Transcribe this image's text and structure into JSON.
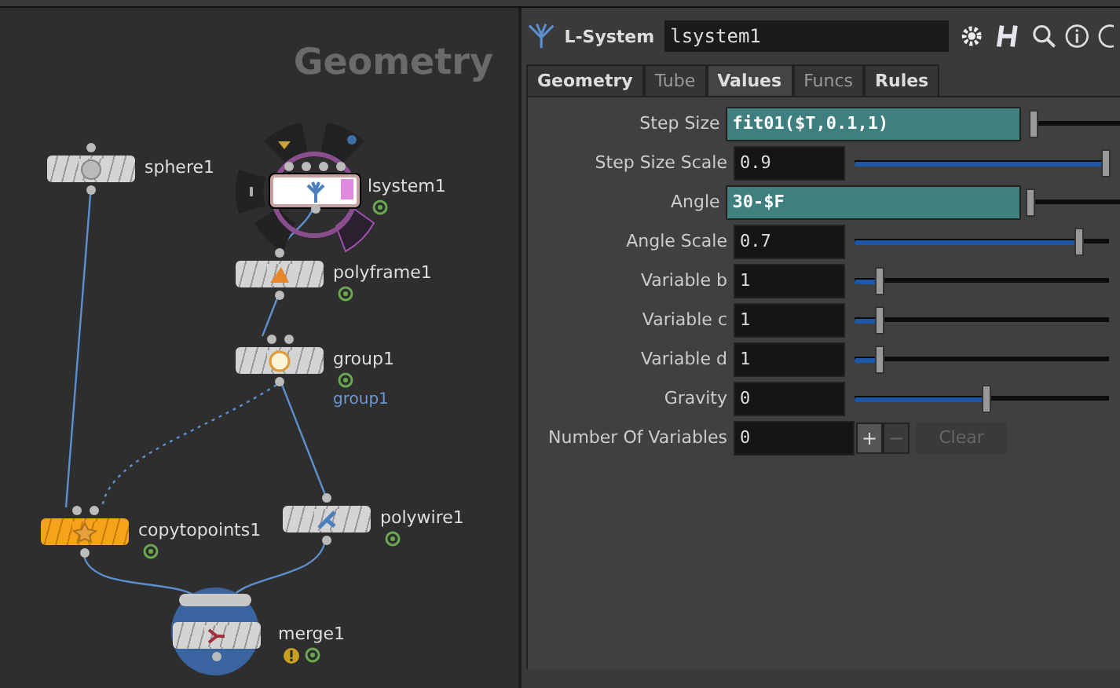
{
  "network": {
    "title": "Geometry",
    "nodes": [
      {
        "name": "sphere1",
        "selected": false,
        "current": false,
        "display": false
      },
      {
        "name": "lsystem1",
        "selected": false,
        "current": true,
        "display": false,
        "badges": [
          {
            "kind": "status"
          }
        ]
      },
      {
        "name": "polyframe1",
        "selected": false,
        "current": false,
        "display": false,
        "badges": [
          {
            "kind": "status"
          }
        ]
      },
      {
        "name": "group1",
        "selected": false,
        "current": false,
        "display": false,
        "badges": [
          {
            "kind": "status"
          }
        ],
        "note": "group1"
      },
      {
        "name": "copytopoints1",
        "selected": true,
        "current": false,
        "display": false,
        "badges": [
          {
            "kind": "status"
          }
        ]
      },
      {
        "name": "polywire1",
        "selected": false,
        "current": false,
        "display": false,
        "badges": [
          {
            "kind": "status"
          }
        ]
      },
      {
        "name": "merge1",
        "selected": false,
        "current": false,
        "display": true,
        "badges": [
          {
            "kind": "warning"
          },
          {
            "kind": "status"
          }
        ]
      }
    ]
  },
  "params": {
    "type_label": "L-System",
    "node_name": "lsystem1",
    "tabs": [
      {
        "label": "Geometry",
        "selected": false,
        "modified": true
      },
      {
        "label": "Tube",
        "selected": false,
        "modified": false
      },
      {
        "label": "Values",
        "selected": true,
        "modified": true
      },
      {
        "label": "Funcs",
        "selected": false,
        "modified": false
      },
      {
        "label": "Rules",
        "selected": false,
        "modified": true
      }
    ],
    "rows": [
      {
        "label": "Step Size",
        "kind": "expression",
        "value": "fit01($T,0.1,1)",
        "level": 0.05
      },
      {
        "label": "Step Size Scale",
        "kind": "number",
        "value": "0.9",
        "level": 0.99
      },
      {
        "label": "Angle",
        "kind": "expression",
        "value": "30-$F",
        "level": 0.02
      },
      {
        "label": "Angle Scale",
        "kind": "number",
        "value": "0.7",
        "level": 0.88
      },
      {
        "label": "Variable b",
        "kind": "number",
        "value": "1",
        "level": 0.1
      },
      {
        "label": "Variable c",
        "kind": "number",
        "value": "1",
        "level": 0.1
      },
      {
        "label": "Variable d",
        "kind": "number",
        "value": "1",
        "level": 0.1
      },
      {
        "label": "Gravity",
        "kind": "number",
        "value": "0",
        "level": 0.52
      },
      {
        "label": "Number Of Variables",
        "kind": "multi",
        "value": "0",
        "add": "+",
        "remove": "−",
        "remove_disabled": true,
        "clear": "Clear",
        "clear_disabled": true
      }
    ]
  }
}
